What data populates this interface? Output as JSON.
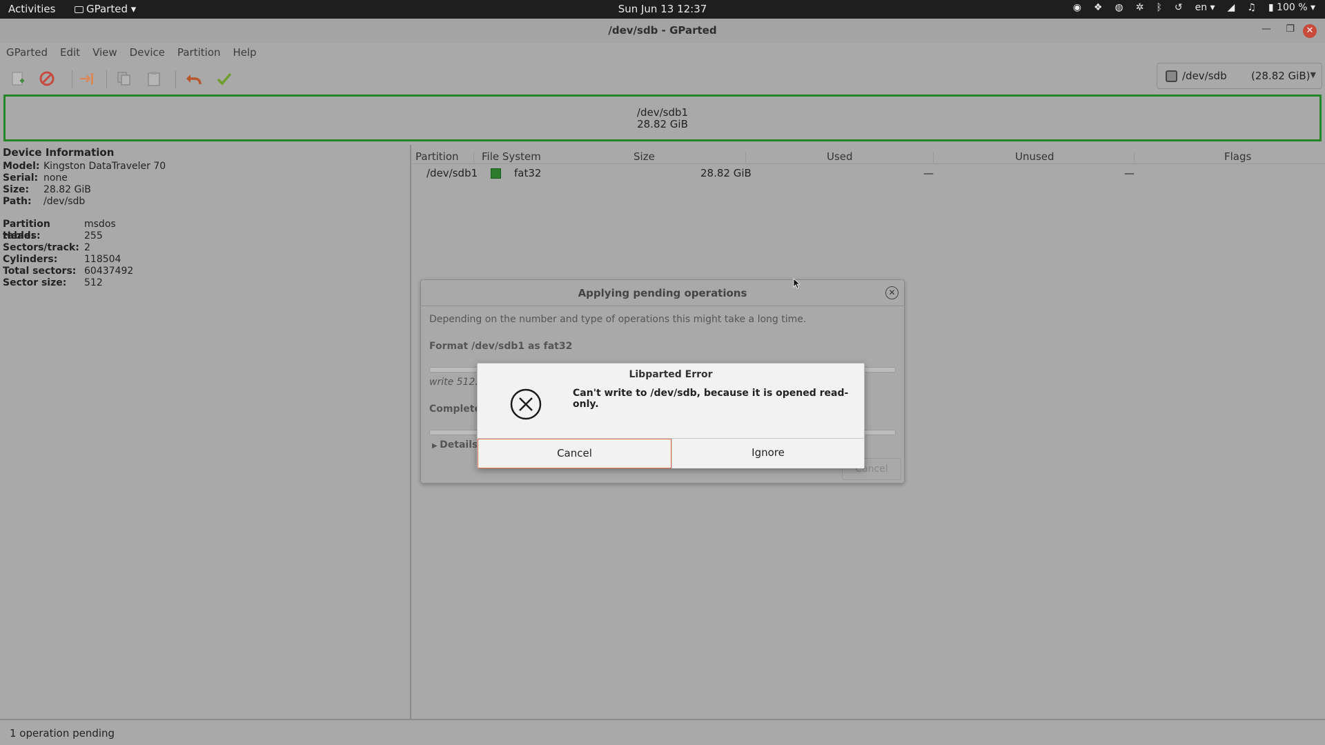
{
  "topbar": {
    "activities": "Activities",
    "app_menu": "GParted ▾",
    "clock": "Sun Jun 13  12:37",
    "lang": "en ▾",
    "battery": "100 % ▾"
  },
  "window": {
    "title": "/dev/sdb - GParted"
  },
  "menu": {
    "items": [
      "GParted",
      "Edit",
      "View",
      "Device",
      "Partition",
      "Help"
    ]
  },
  "device_selector": {
    "name": "/dev/sdb",
    "size": "(28.82 GiB)"
  },
  "partition_map": {
    "name": "/dev/sdb1",
    "size": "28.82 GiB"
  },
  "device_info": {
    "heading": "Device Information",
    "rows1": [
      {
        "k": "Model:",
        "v": "Kingston DataTraveler 70"
      },
      {
        "k": "Serial:",
        "v": "none"
      },
      {
        "k": "Size:",
        "v": "28.82 GiB"
      },
      {
        "k": "Path:",
        "v": "/dev/sdb"
      }
    ],
    "rows2": [
      {
        "k": "Partition table:",
        "v": "msdos"
      },
      {
        "k": "Heads:",
        "v": "255"
      },
      {
        "k": "Sectors/track:",
        "v": "2"
      },
      {
        "k": "Cylinders:",
        "v": "118504"
      },
      {
        "k": "Total sectors:",
        "v": "60437492"
      },
      {
        "k": "Sector size:",
        "v": "512"
      }
    ]
  },
  "table": {
    "headers": [
      "Partition",
      "File System",
      "Size",
      "Used",
      "Unused",
      "Flags"
    ],
    "rows": [
      {
        "partition": "/dev/sdb1",
        "fs": "fat32",
        "fs_color": "#2c7a2c",
        "size": "28.82 GiB",
        "used": "—",
        "unused": "—",
        "flags": ""
      }
    ]
  },
  "status": {
    "text": "1 operation pending"
  },
  "apply_dialog": {
    "title": "Applying pending operations",
    "text": "Depending on the number and type of operations this might take a long time.",
    "operation": "Format /dev/sdb1 as fat32",
    "write_text": "write 512.0",
    "completed_text": "Complete",
    "details": "Details",
    "cancel": "Cancel"
  },
  "error_dialog": {
    "title": "Libparted Error",
    "message": "Can't write to /dev/sdb, because it is opened read-only.",
    "cancel": "Cancel",
    "ignore": "Ignore"
  }
}
